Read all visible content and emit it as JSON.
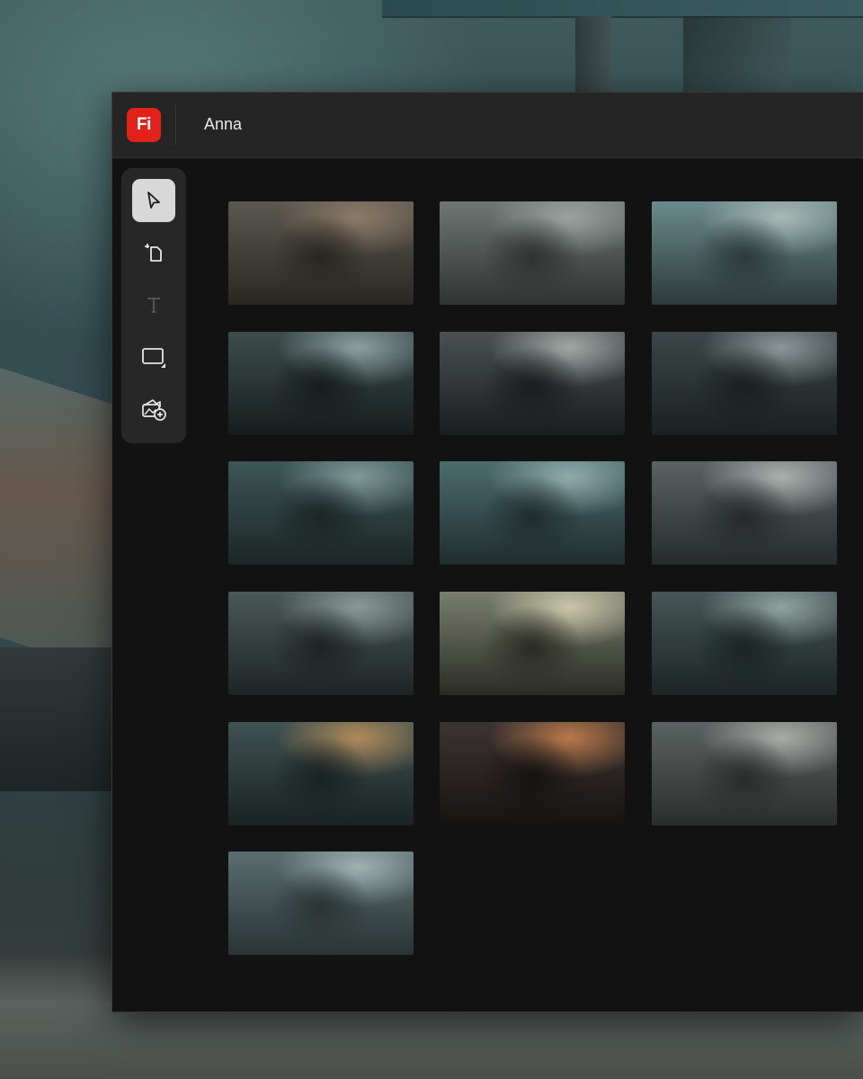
{
  "app": {
    "logo_text": "Fi",
    "project_title": "Anna",
    "brand_color": "#e1221a"
  },
  "toolbar": {
    "tools": [
      {
        "icon": "select-arrow-icon",
        "active": true
      },
      {
        "icon": "crop-rotate-icon",
        "active": false
      },
      {
        "icon": "text-tool-icon",
        "active": false,
        "disabled": true
      },
      {
        "icon": "frame-shape-icon",
        "active": false
      },
      {
        "icon": "add-image-icon",
        "active": false
      }
    ]
  },
  "gallery": {
    "images": [
      {
        "scene": "woman-aiming-rifle",
        "palette": [
          "#5b5850",
          "#2a2622",
          "#8a7a66"
        ]
      },
      {
        "scene": "robot-crouching-street",
        "palette": [
          "#6f7674",
          "#2f3332",
          "#9aa3a0"
        ]
      },
      {
        "scene": "girl-facing-city",
        "palette": [
          "#6c8a8c",
          "#2c3a3a",
          "#a6b9b6"
        ]
      },
      {
        "scene": "caped-figure-hall",
        "palette": [
          "#3e4d4d",
          "#161c1c",
          "#8aa0a0"
        ]
      },
      {
        "scene": "robot-in-hall",
        "palette": [
          "#4a5050",
          "#1a1d1d",
          "#a0a8a6"
        ]
      },
      {
        "scene": "robot-red-eye-ruins",
        "palette": [
          "#3b4748",
          "#1a2021",
          "#8a9697"
        ]
      },
      {
        "scene": "woman-in-street",
        "palette": [
          "#3d5556",
          "#1c2626",
          "#7f9898"
        ]
      },
      {
        "scene": "aerial-ruined-city",
        "palette": [
          "#4d6c6e",
          "#1f2d2e",
          "#90abaa"
        ]
      },
      {
        "scene": "robot-army-street",
        "palette": [
          "#5a6262",
          "#262a2a",
          "#a9b0ae"
        ]
      },
      {
        "scene": "woman-against-wall",
        "palette": [
          "#4a5858",
          "#1e2424",
          "#8a9a96"
        ]
      },
      {
        "scene": "woman-punching-window",
        "palette": [
          "#7a7e6e",
          "#2a2c24",
          "#c8c6a8"
        ]
      },
      {
        "scene": "man-in-ruined-room",
        "palette": [
          "#465656",
          "#1c2424",
          "#8fa2a0"
        ]
      },
      {
        "scene": "armored-car-explosion",
        "palette": [
          "#405252",
          "#1a2222",
          "#b08a5a"
        ]
      },
      {
        "scene": "woman-driving",
        "palette": [
          "#3a3432",
          "#171312",
          "#b9784a"
        ]
      },
      {
        "scene": "car-vs-robots",
        "palette": [
          "#5c6261",
          "#2a2d2c",
          "#a8aca8"
        ]
      },
      {
        "scene": "girl-overlooking-city",
        "palette": [
          "#5a6e70",
          "#2a3334",
          "#9eb2b0"
        ]
      }
    ]
  }
}
